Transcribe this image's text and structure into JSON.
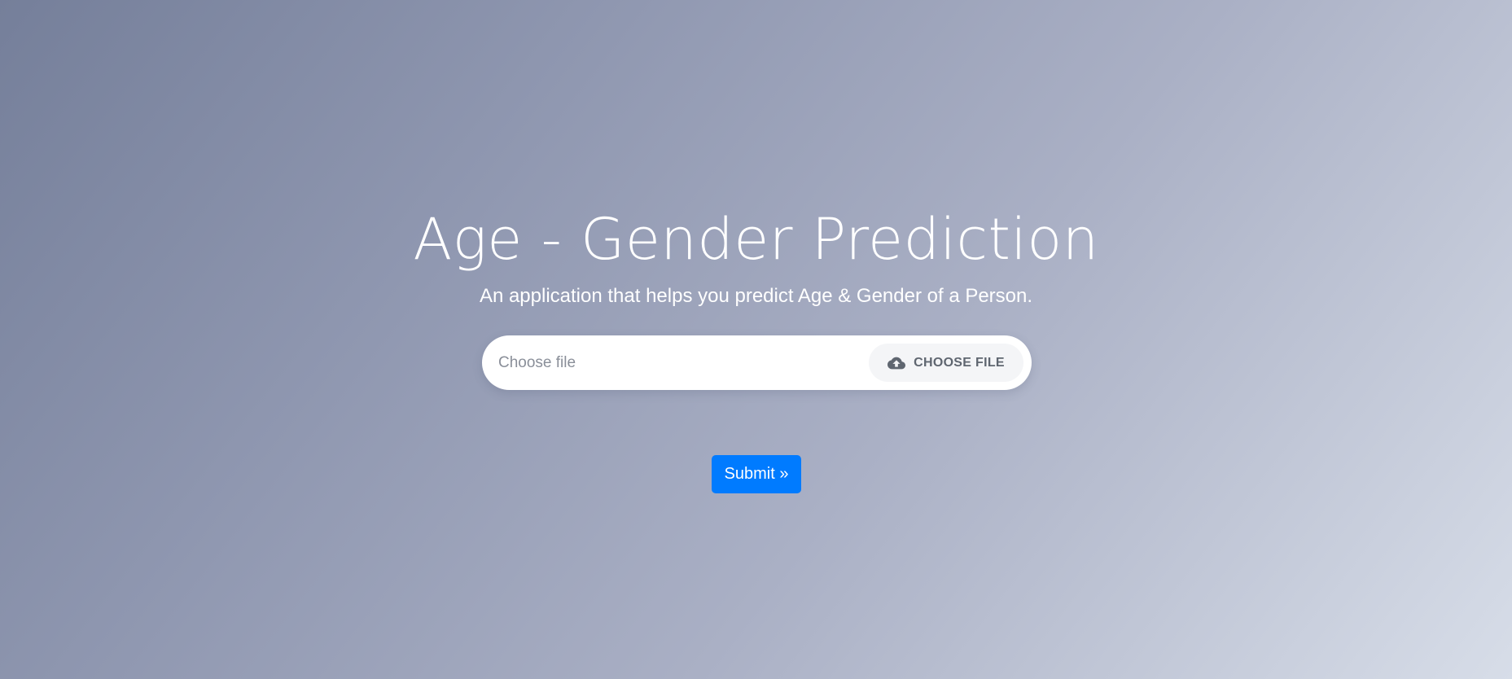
{
  "header": {
    "title": "Age - Gender Prediction",
    "subtitle": "An application that helps you predict Age & Gender of a Person."
  },
  "upload": {
    "label": "Choose file",
    "button_label": "CHOOSE FILE",
    "button_icon": "cloud-upload-icon"
  },
  "form": {
    "submit_label": "Submit »"
  },
  "colors": {
    "gradient_start": "#757f9a",
    "gradient_end": "#d7dde8",
    "accent": "#007bff"
  }
}
